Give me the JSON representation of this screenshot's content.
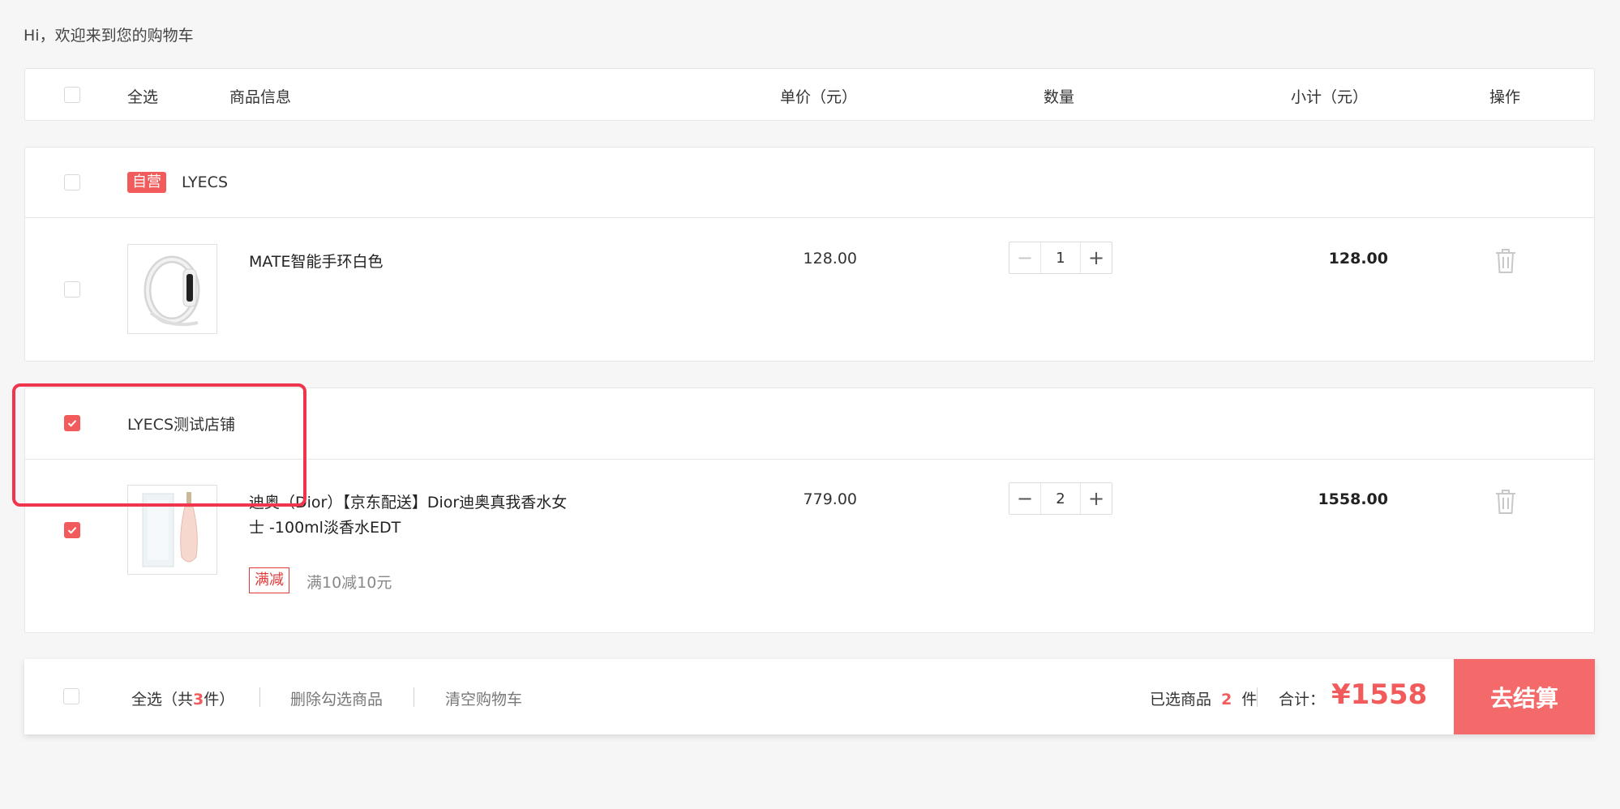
{
  "greeting": "Hi，欢迎来到您的购物车",
  "header": {
    "select_all": "全选",
    "product_info": "商品信息",
    "unit_price": "单价（元）",
    "quantity": "数量",
    "subtotal": "小计（元）",
    "actions": "操作"
  },
  "shops": [
    {
      "badge": "自营",
      "name": "LYECS",
      "checked": false,
      "items": [
        {
          "name": "MATE智能手环白色",
          "price": "128.00",
          "qty": "1",
          "subtotal": "128.00",
          "checked": false
        }
      ]
    },
    {
      "name": "LYECS测试店铺",
      "checked": true,
      "items": [
        {
          "name_line1": "迪奥（Dior）【京东配送】Dior迪奥真我香水女",
          "name_line2": "士 -100ml淡香水EDT",
          "price": "779.00",
          "qty": "2",
          "subtotal": "1558.00",
          "checked": true,
          "promo_tag": "满减",
          "promo_text": "满10减10元"
        }
      ]
    }
  ],
  "footer": {
    "select_all_prefix": "全选（共",
    "total_count": "3",
    "select_all_suffix": "件）",
    "delete_selected": "删除勾选商品",
    "clear_cart": "清空购物车",
    "selected_prefix": "已选商品",
    "selected_count": "2",
    "selected_suffix": "件",
    "total_label": "合计：",
    "total_amount": "¥1558",
    "checkout": "去结算"
  },
  "colors": {
    "accent": "#f25b5b",
    "checkout_bg": "#f46a6a",
    "highlight": "#f0364c"
  }
}
